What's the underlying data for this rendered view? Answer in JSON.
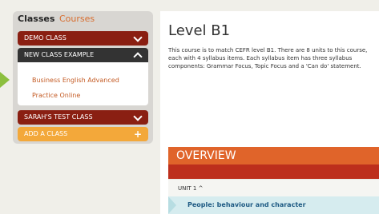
{
  "sidebar": {
    "tabs": [
      {
        "label": "Classes"
      },
      {
        "label": "Courses"
      }
    ],
    "items": [
      {
        "label": "DEMO CLASS"
      },
      {
        "label": "NEW CLASS EXAMPLE",
        "expanded": true,
        "sub_items": [
          "Business English Advanced Practice Online"
        ]
      },
      {
        "label": "SARAH'S TEST CLASS"
      },
      {
        "label": "ADD A CLASS"
      }
    ]
  },
  "main": {
    "title": "Level B1",
    "description": "This course is to match CEFR level B1. There are 8 units to this course, each with 4 syllabus items. Each syllabus item has three syllabus components: Grammar Focus, Topic Focus and a 'Can do' statement.",
    "overview_label": "OVERVIEW",
    "unit": {
      "label": "UNIT 1 ^"
    },
    "syllabus_item": "People: behaviour and character"
  },
  "colors": {
    "red": "#8a1f12",
    "dark": "#333333",
    "orange": "#f3a83a",
    "overview_orange": "#e0642a",
    "link": "#c45b24"
  }
}
